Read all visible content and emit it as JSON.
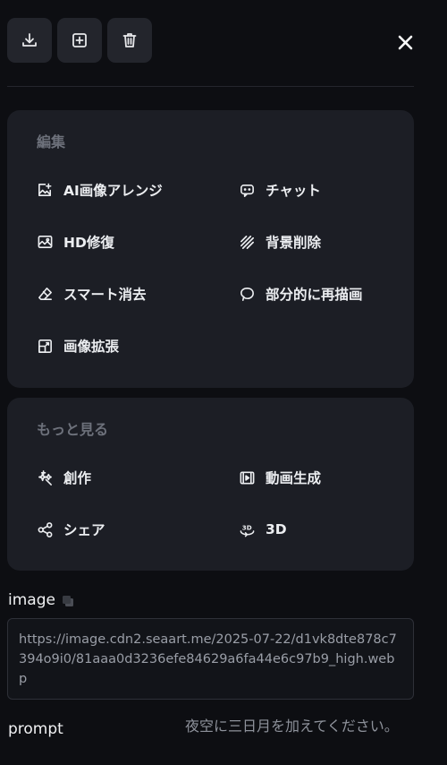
{
  "toolbar": {
    "buttons": [
      {
        "name": "download-icon"
      },
      {
        "name": "add-square-icon"
      },
      {
        "name": "trash-icon"
      }
    ],
    "close_icon": "close-icon"
  },
  "edit_section": {
    "title": "編集",
    "items": [
      {
        "label": "AI画像アレンジ",
        "icon": "image-edit-icon"
      },
      {
        "label": "チャット",
        "icon": "chat-bot-icon"
      },
      {
        "label": "HD修復",
        "icon": "image-hd-icon"
      },
      {
        "label": "背景削除",
        "icon": "stripes-icon"
      },
      {
        "label": "スマート消去",
        "icon": "eraser-icon"
      },
      {
        "label": "部分的に再描画",
        "icon": "lasso-icon"
      },
      {
        "label": "画像拡張",
        "icon": "expand-image-icon"
      }
    ]
  },
  "more_section": {
    "title": "もっと見る",
    "items": [
      {
        "label": "創作",
        "icon": "sparkle-create-icon"
      },
      {
        "label": "動画生成",
        "icon": "video-icon"
      },
      {
        "label": "シェア",
        "icon": "share-icon"
      },
      {
        "label": "3D",
        "icon": "3d-rotate-icon"
      }
    ]
  },
  "fields": {
    "image_label": "image",
    "image_value": "https://image.cdn2.seaart.me/2025-07-22/d1vk8dte878c7394o9i0/81aaa0d3236efe84629a6fa44e6c97b9_high.webp",
    "prompt_label": "prompt",
    "prompt_value": "夜空に三日月を加えてください。"
  },
  "colors": {
    "background": "#0d0e12",
    "card": "#1c1e25",
    "button": "#23252c",
    "section_title": "#6d717b"
  }
}
